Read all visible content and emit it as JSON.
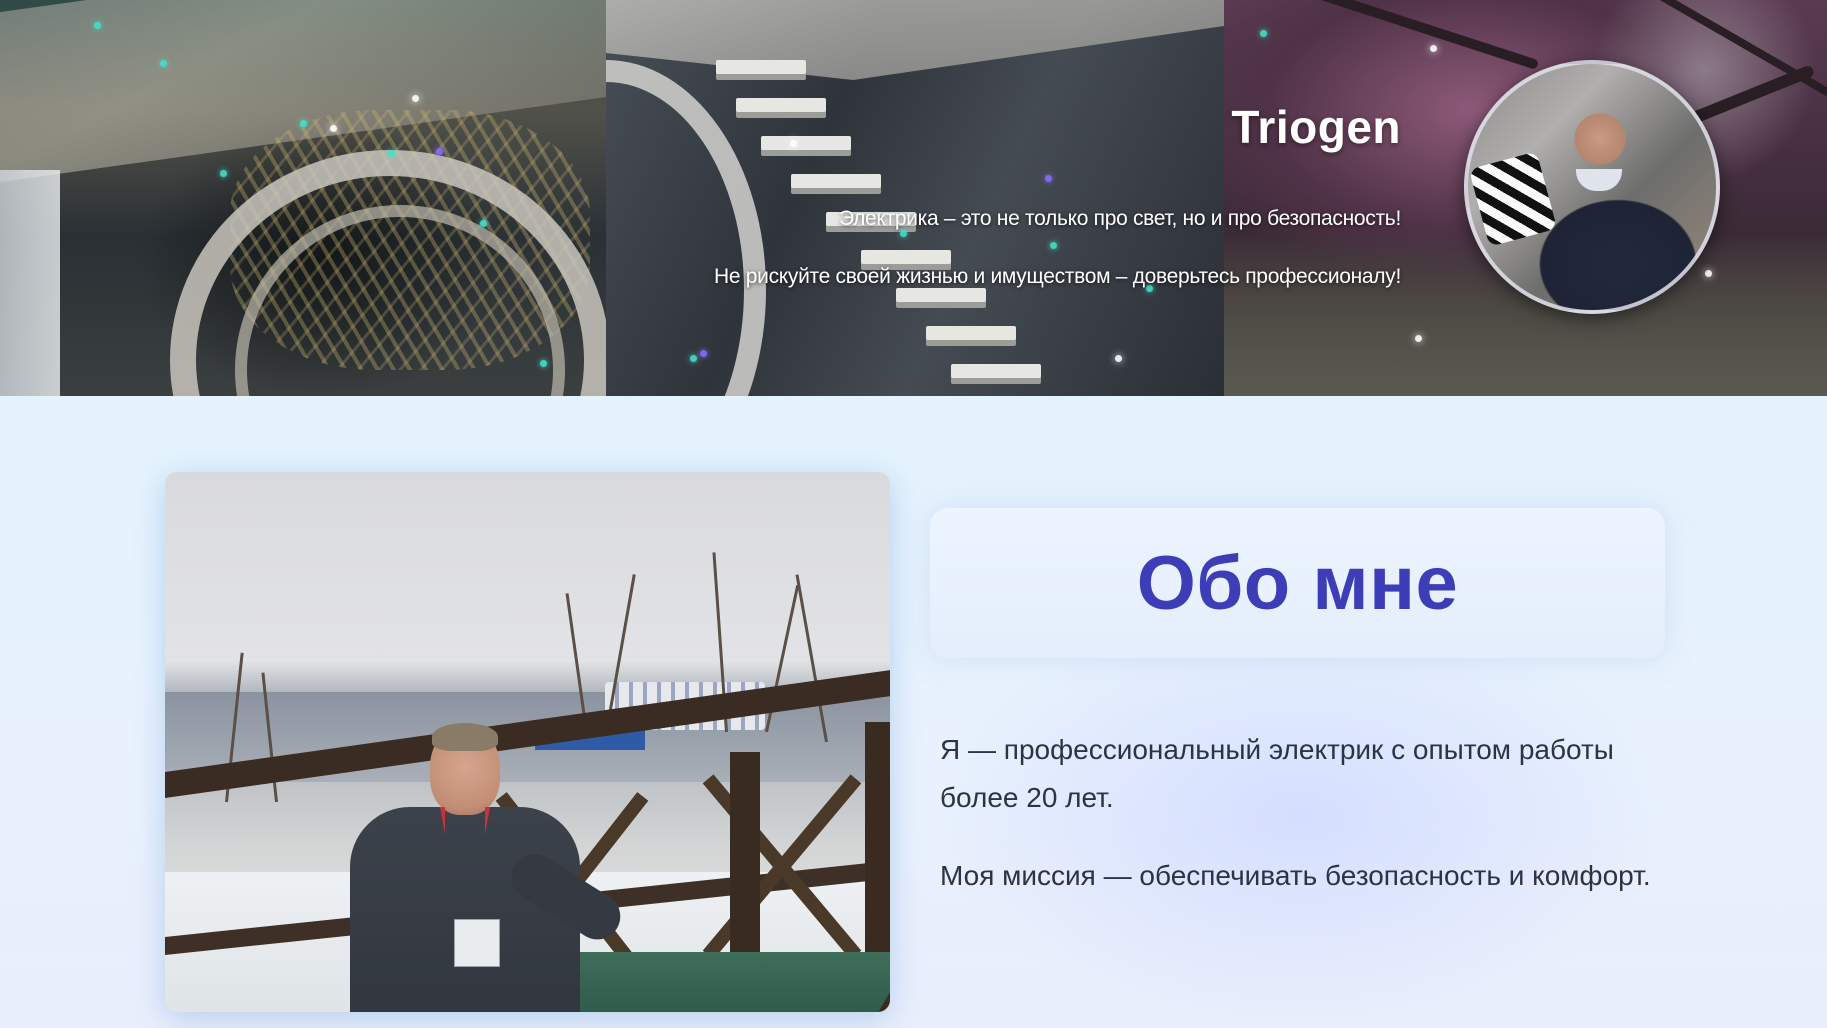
{
  "hero": {
    "brand": "Triogen",
    "line_1": "Электрика – это не только про свет, но и про безопасность!",
    "line_2": "Не рискуйте своей жизнью и имуществом – доверьтесь профессионалу!"
  },
  "about": {
    "title": "Обо мне",
    "paragraph_1": "Я — профессиональный электрик с опытом работы более 20 лет.",
    "paragraph_2": "Моя миссия — обеспечивать безопасность и комфорт."
  },
  "colors": {
    "title_accent": "#3d3db8",
    "body_text": "#2b3444",
    "page_background": "#e8f2fd",
    "sparkle": "#45e0c8"
  }
}
